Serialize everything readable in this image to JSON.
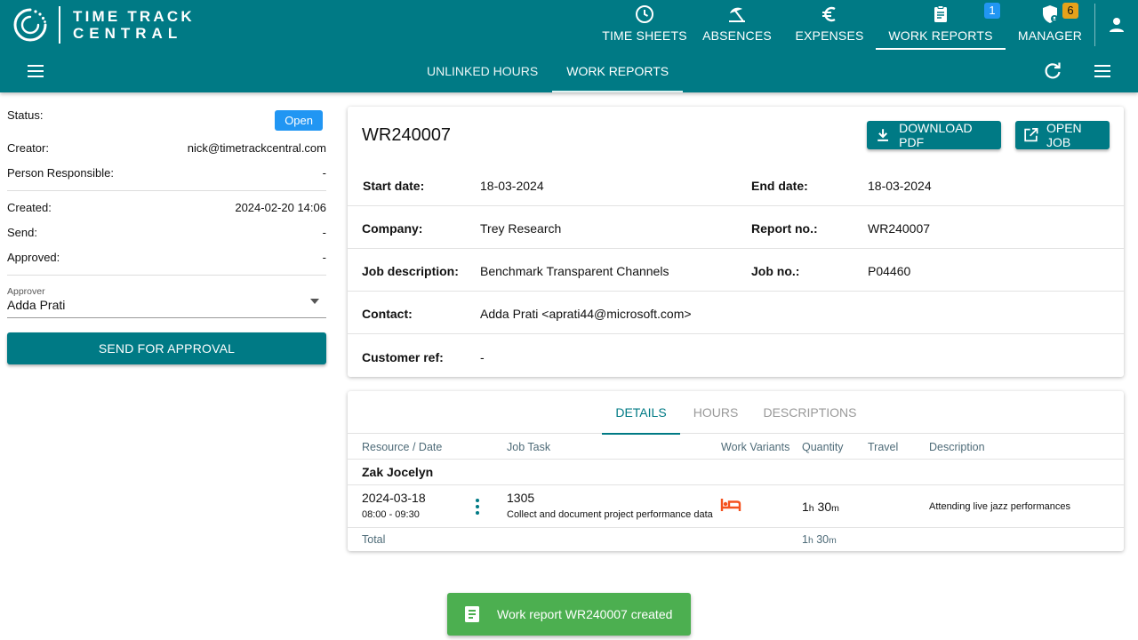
{
  "app": {
    "logo_line1": "TIME TRACK",
    "logo_line2": "CENTRAL"
  },
  "nav": {
    "items": [
      {
        "label": "TIME SHEETS",
        "icon": "clock-icon"
      },
      {
        "label": "ABSENCES",
        "icon": "beach-umbrella-icon"
      },
      {
        "label": "EXPENSES",
        "icon": "euro-icon"
      },
      {
        "label": "WORK REPORTS",
        "icon": "clipboard-icon",
        "badge": "1",
        "active": true
      },
      {
        "label": "MANAGER",
        "icon": "shield-user-icon",
        "badge": "6"
      }
    ]
  },
  "subnav": {
    "tabs": [
      {
        "label": "UNLINKED HOURS"
      },
      {
        "label": "WORK REPORTS",
        "active": true
      }
    ]
  },
  "left": {
    "status_label": "Status:",
    "status_value": "Open",
    "creator_label": "Creator:",
    "creator_value": "nick@timetrackcentral.com",
    "person_label": "Person Responsible:",
    "person_value": "-",
    "created_label": "Created:",
    "created_value": "2024-02-20 14:06",
    "send_label": "Send:",
    "send_value": "-",
    "approved_label": "Approved:",
    "approved_value": "-",
    "approver_label": "Approver",
    "approver_value": "Adda Prati",
    "send_button": "SEND FOR APPROVAL"
  },
  "report": {
    "title": "WR240007",
    "download_pdf": "DOWNLOAD PDF",
    "open_job": "OPEN JOB",
    "start_label": "Start date:",
    "start_value": "18-03-2024",
    "end_label": "End date:",
    "end_value": "18-03-2024",
    "company_label": "Company:",
    "company_value": "Trey Research",
    "report_no_label": "Report no.:",
    "report_no_value": "WR240007",
    "jobdesc_label": "Job description:",
    "jobdesc_value": "Benchmark Transparent Channels",
    "job_no_label": "Job no.:",
    "job_no_value": "P04460",
    "contact_label": "Contact:",
    "contact_value": "Adda Prati <aprati44@microsoft.com>",
    "custref_label": "Customer ref:",
    "custref_value": "-"
  },
  "details": {
    "tabs": [
      {
        "label": "DETAILS",
        "active": true
      },
      {
        "label": "HOURS"
      },
      {
        "label": "DESCRIPTIONS"
      }
    ],
    "columns": {
      "resource_date": "Resource / Date",
      "job_task": "Job Task",
      "work_variants": "Work Variants",
      "quantity": "Quantity",
      "travel": "Travel",
      "description": "Description"
    },
    "group_name": "Zak Jocelyn",
    "row": {
      "date": "2024-03-18",
      "time": "08:00 - 09:30",
      "task_no": "1305",
      "task_name": "Collect and document project performance data",
      "variant_icon": "bed-icon",
      "qty_h": "1",
      "qty_h_unit": "h",
      "qty_m": "30",
      "qty_m_unit": "m",
      "description": "Attending live jazz performances"
    },
    "total_label": "Total",
    "total_h": "1",
    "total_h_unit": "h",
    "total_m": "30",
    "total_m_unit": "m"
  },
  "toast": {
    "message": "Work report WR240007 created"
  },
  "colors": {
    "primary": "#007a85",
    "open_chip": "#2196f3",
    "toast": "#4caf50",
    "badge_blue": "#2196f3",
    "badge_orange": "#e6a21a",
    "variant_icon": "#f4511e"
  }
}
